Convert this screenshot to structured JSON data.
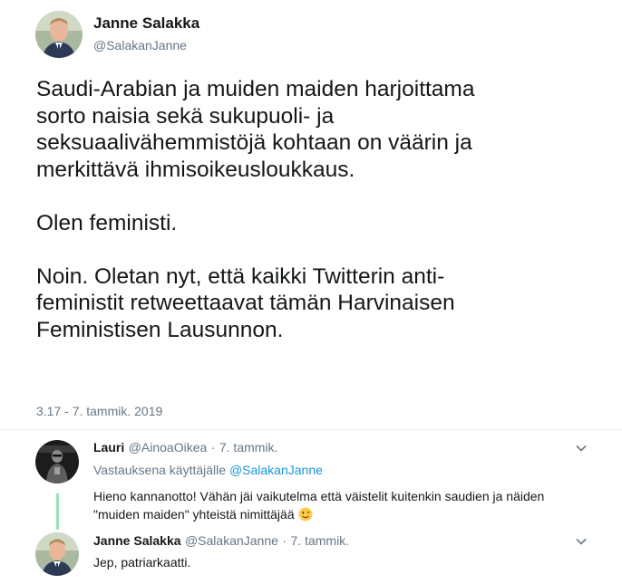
{
  "tweet": {
    "author_name": "Janne Salakka",
    "author_handle": "@SalakanJanne",
    "paragraph1": "Saudi-Arabian ja muiden maiden harjoittama\nsorto naisia sekä sukupuoli- ja\nseksuaalivähemmistöjä kohtaan on väärin ja\nmerkittävä ihmisoikeusloukkaus.",
    "paragraph2": "Olen feministi.",
    "paragraph3": "Noin. Oletan nyt, että kaikki Twitterin anti-\nfeministit retweettaavat tämän Harvinaisen\nFeministisen Lausunnon.",
    "timestamp": "3.17 - 7. tammik. 2019"
  },
  "replies": [
    {
      "name": "Lauri",
      "handle": "@AinoaOikea",
      "sep": "·",
      "date": "7. tammik.",
      "context_prefix": "Vastauksena käyttäjälle",
      "context_handle": "@SalakanJanne",
      "text_line1": "Hieno kannanotto! Vähän jäi vaikutelma että väistelit kuitenkin saudien ja näiden",
      "text_line2": "\"muiden maiden\" yhteistä nimittäjää",
      "emoji": "wink-emoji-icon"
    },
    {
      "name": "Janne Salakka",
      "handle": "@SalakanJanne",
      "sep": "·",
      "date": "7. tammik.",
      "text": "Jep, patriarkaatti."
    }
  ],
  "colors": {
    "link": "#1b95e0",
    "secondary_text": "#657786",
    "thread_line": "#9ae2ba"
  }
}
